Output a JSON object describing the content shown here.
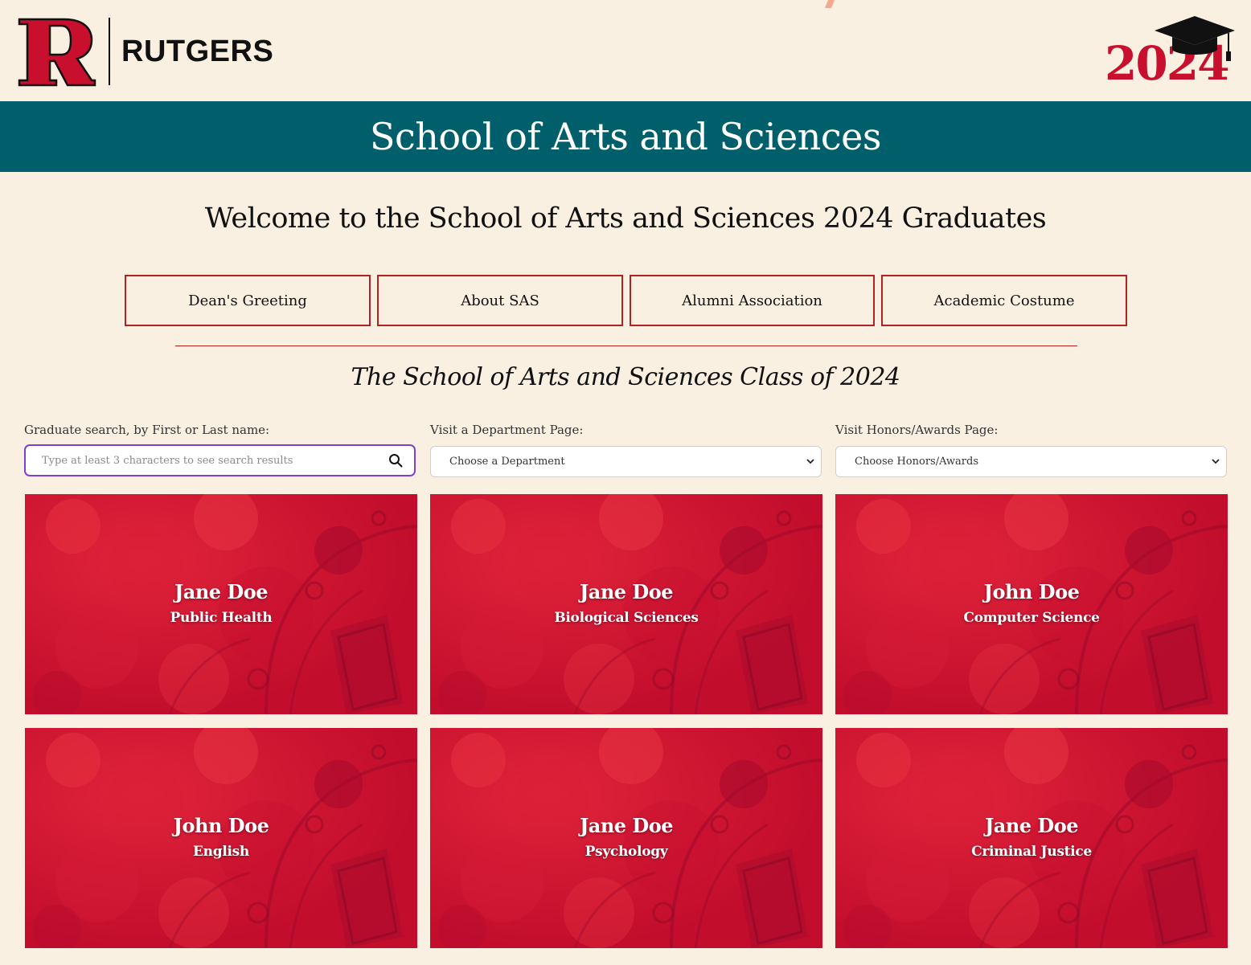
{
  "header": {
    "wordmark": "RUTGERS",
    "logo_letter": "R",
    "year": "2024",
    "brand_red": "#c8102e"
  },
  "banner": {
    "title": "School of Arts and Sciences",
    "color": "#005f6b"
  },
  "welcome": "Welcome to the School of Arts and Sciences 2024 Graduates",
  "nav": [
    {
      "label": "Dean's Greeting"
    },
    {
      "label": "About SAS"
    },
    {
      "label": "Alumni Association"
    },
    {
      "label": "Academic Costume"
    }
  ],
  "class_heading": "The School of Arts and Sciences Class of 2024",
  "search": {
    "label": "Graduate search, by First or Last name:",
    "placeholder": "Type at least 3 characters to see search results",
    "value": "",
    "icon": "search-icon"
  },
  "department": {
    "label": "Visit a Department Page:",
    "selected": "Choose a Department"
  },
  "honors": {
    "label": "Visit Honors/Awards Page:",
    "selected": "Choose Honors/Awards"
  },
  "graduates": [
    {
      "name": "Jane Doe",
      "department": "Public Health"
    },
    {
      "name": "Jane Doe",
      "department": "Biological Sciences"
    },
    {
      "name": "John Doe",
      "department": "Computer Science"
    },
    {
      "name": "John Doe",
      "department": "English"
    },
    {
      "name": "Jane Doe",
      "department": "Psychology"
    },
    {
      "name": "Jane Doe",
      "department": "Criminal Justice"
    }
  ],
  "colors": {
    "page_background": "#f9f0e1",
    "accent_border": "#b22222",
    "search_focus": "#7b3fd6",
    "card_overlay": "#c8102e"
  }
}
